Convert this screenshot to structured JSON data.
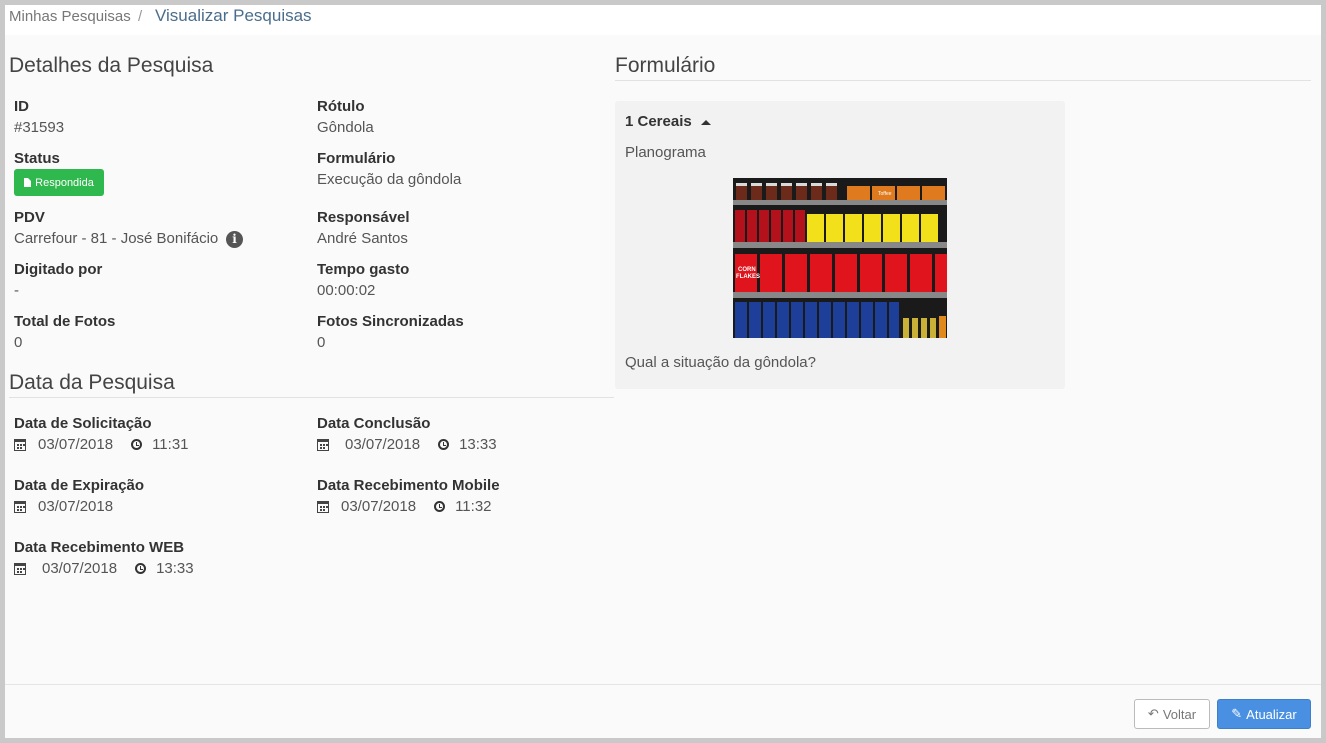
{
  "breadcrumb": {
    "parent": "Minhas Pesquisas",
    "separator": "/",
    "current": "Visualizar Pesquisas"
  },
  "detalhes": {
    "title": "Detalhes da Pesquisa",
    "id_label": "ID",
    "id_value": "#31593",
    "rotulo_label": "Rótulo",
    "rotulo_value": "Gôndola",
    "status_label": "Status",
    "status_badge": "Respondida",
    "formulario_label": "Formulário",
    "formulario_value": "Execução da gôndola",
    "pdv_label": "PDV",
    "pdv_value": "Carrefour - 81 - José Bonifácio",
    "responsavel_label": "Responsável",
    "responsavel_value": "André Santos",
    "digitado_label": "Digitado por",
    "digitado_value": "-",
    "tempo_label": "Tempo gasto",
    "tempo_value": "00:00:02",
    "fotos_label": "Total de Fotos",
    "fotos_value": "0",
    "sinc_label": "Fotos Sincronizadas",
    "sinc_value": "0"
  },
  "datas": {
    "title": "Data da Pesquisa",
    "solicitacao": {
      "label": "Data de Solicitação",
      "date": "03/07/2018",
      "time": "11:31"
    },
    "conclusao": {
      "label": "Data Conclusão",
      "date": "03/07/2018",
      "time": "13:33"
    },
    "expiracao": {
      "label": "Data de Expiração",
      "date": "03/07/2018"
    },
    "mobile": {
      "label": "Data Recebimento Mobile",
      "date": "03/07/2018",
      "time": "11:32"
    },
    "web": {
      "label": "Data Recebimento WEB",
      "date": "03/07/2018",
      "time": "13:33"
    }
  },
  "formulario": {
    "title": "Formulário",
    "question_group": "1 Cereais",
    "item": "Planograma",
    "question": "Qual a situação da gôndola?",
    "shelf_labels": {
      "corn": "CORN",
      "flakes": "FLAKES",
      "toffee": "Toffee"
    }
  },
  "actions": {
    "voltar": "Voltar",
    "atualizar": "Atualizar"
  },
  "colors": {
    "status_green": "#2fb84d",
    "primary_blue": "#4a90e2",
    "breadcrumb_link": "#4a6d8c"
  },
  "icons": {
    "status": "file-icon",
    "info": "info-circle-icon",
    "calendar": "calendar-icon",
    "clock": "clock-icon",
    "back": "undo-icon",
    "edit": "pencil-icon"
  }
}
